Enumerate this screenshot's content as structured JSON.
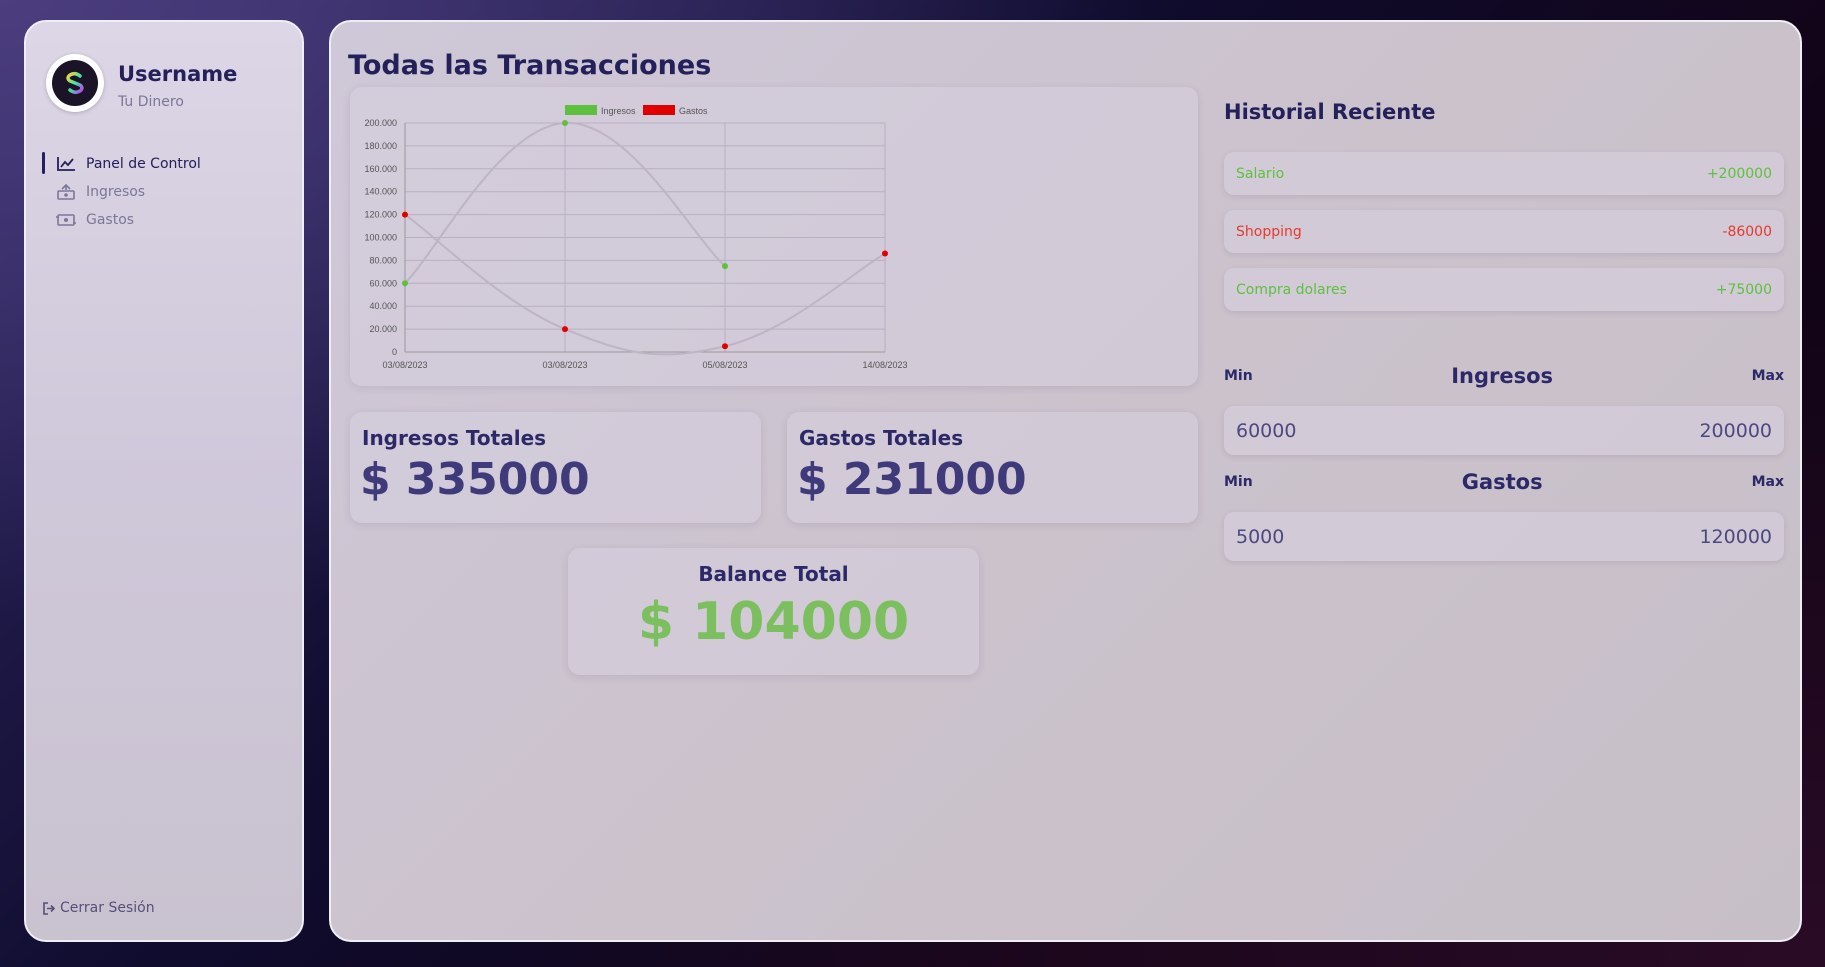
{
  "sidebar": {
    "username": "Username",
    "tagline": "Tu Dinero",
    "nav": [
      {
        "label": "Panel de Control",
        "icon": "line-chart-icon",
        "active": true
      },
      {
        "label": "Ingresos",
        "icon": "money-in-icon",
        "active": false
      },
      {
        "label": "Gastos",
        "icon": "money-out-icon",
        "active": false
      }
    ],
    "logout": "Cerrar Sesión"
  },
  "main": {
    "title": "Todas las Transacciones",
    "totals": {
      "income_label": "Ingresos Totales",
      "income_value": "$ 335000",
      "expense_label": "Gastos Totales",
      "expense_value": "$ 231000",
      "balance_label": "Balance Total",
      "balance_value": "$ 104000"
    }
  },
  "history": {
    "title": "Historial Reciente",
    "items": [
      {
        "name": "Salario",
        "amount": "+200000",
        "kind": "income"
      },
      {
        "name": "Shopping",
        "amount": "-86000",
        "kind": "expense"
      },
      {
        "name": "Compra dolares",
        "amount": "+75000",
        "kind": "income"
      }
    ]
  },
  "ranges": {
    "income": {
      "title": "Ingresos",
      "min_label": "Min",
      "max_label": "Max",
      "min": "60000",
      "max": "200000"
    },
    "expense": {
      "title": "Gastos",
      "min_label": "Min",
      "max_label": "Max",
      "min": "5000",
      "max": "120000"
    }
  },
  "colors": {
    "income": "#5fbf3f",
    "expense": "#e53a2e",
    "accent": "#24205a"
  },
  "chart_data": {
    "type": "line",
    "categories": [
      "03/08/2023",
      "03/08/2023",
      "05/08/2023",
      "14/08/2023"
    ],
    "series": [
      {
        "name": "Ingresos",
        "color": "#5fbf3f",
        "values": [
          60000,
          200000,
          75000,
          null
        ]
      },
      {
        "name": "Gastos",
        "color": "#e00000",
        "values": [
          120000,
          20000,
          5000,
          86000
        ]
      }
    ],
    "ylim": [
      0,
      200000
    ],
    "yticks": [
      "0",
      "20.000",
      "40.000",
      "60.000",
      "80.000",
      "100.000",
      "120.000",
      "140.000",
      "160.000",
      "180.000",
      "200.000"
    ],
    "legend": "top",
    "grid": true
  }
}
